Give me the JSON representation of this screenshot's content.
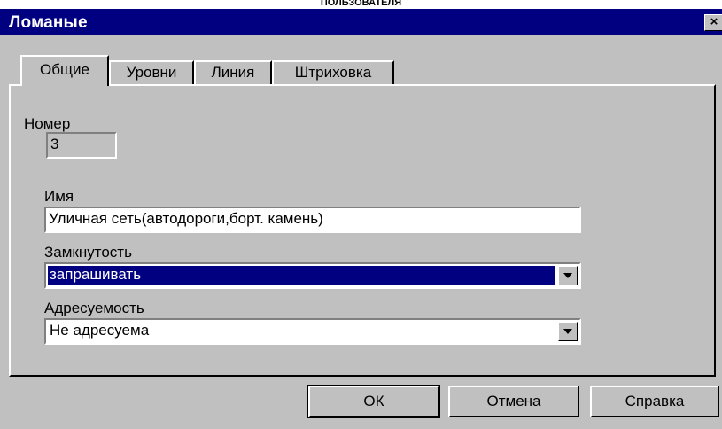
{
  "doc_header": "ПОЛЬЗОВАТЕЛЯ",
  "window": {
    "title": "Ломаные",
    "close_label": "×"
  },
  "tabs": [
    {
      "label": "Общие",
      "active": true
    },
    {
      "label": "Уровни",
      "active": false
    },
    {
      "label": "Линия",
      "active": false
    },
    {
      "label": "Штриховка",
      "active": false
    }
  ],
  "general": {
    "number_label": "Номер",
    "number_value": "3",
    "name_label": "Имя",
    "name_value": "Уличная сеть(автодороги,борт. камень)",
    "closure_label": "Замкнутость",
    "closure_value": "запрашивать",
    "addressable_label": "Адресуемость",
    "addressable_value": "Не адресуема"
  },
  "buttons": {
    "ok": "ОК",
    "cancel": "Отмена",
    "help": "Справка"
  },
  "colors": {
    "titlebar": "#000080",
    "face": "#c0c0c0",
    "selection": "#000080"
  }
}
